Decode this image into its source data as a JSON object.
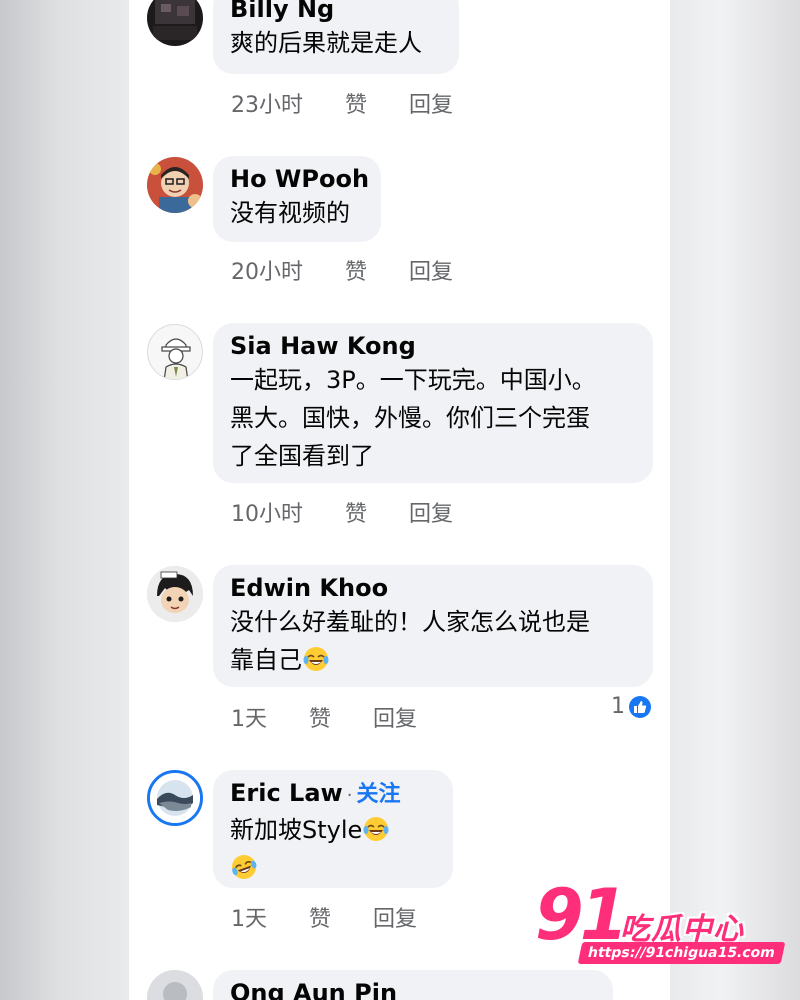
{
  "comments": [
    {
      "author": "Billy Ng",
      "lines": [
        "爽的后果就是走人"
      ],
      "time": "23小时",
      "like": "赞",
      "reply": "回复"
    },
    {
      "author": "Ho WPooh",
      "lines": [
        "没有视频的"
      ],
      "time": "20小时",
      "like": "赞",
      "reply": "回复"
    },
    {
      "author": "Sia Haw Kong",
      "lines": [
        "一起玩，3P。一下玩完。中国小。",
        "黑大。国快，外慢。你们三个完蛋",
        "了全国看到了"
      ],
      "time": "10小时",
      "like": "赞",
      "reply": "回复"
    },
    {
      "author": "Edwin Khoo",
      "lines": [
        "没什么好羞耻的！人家怎么说也是",
        "靠自己"
      ],
      "time": "1天",
      "like": "赞",
      "reply": "回复",
      "reaction_count": "1"
    },
    {
      "author": "Eric Law",
      "follow": "关注",
      "lines": [
        "新加坡Style"
      ],
      "time": "1天",
      "like": "赞",
      "reply": "回复"
    },
    {
      "author": "Ong Aun Pin"
    }
  ],
  "watermark": {
    "number": "91",
    "name": "吃瓜中心",
    "url": "https://91chigua15.com"
  },
  "colors": {
    "link": "#1877f2",
    "bubble": "#f0f2f5",
    "meta": "#65676b",
    "watermark": "#ff2e7a"
  },
  "icons": [
    "laughing-emoji-icon",
    "like-thumb-icon"
  ]
}
